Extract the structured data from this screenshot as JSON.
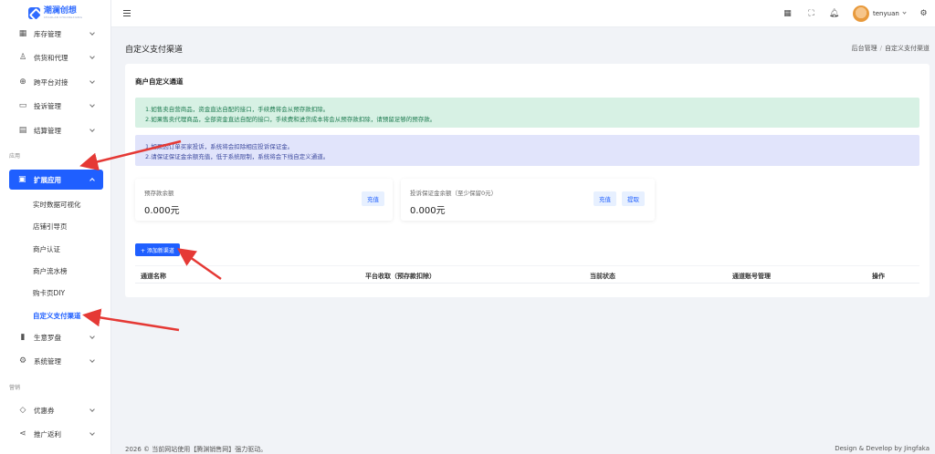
{
  "logo": {
    "name": "潮澜创想",
    "sub": "CHAOLAN CHUANGXIANG"
  },
  "sidebar": {
    "items": [
      {
        "label": "库存管理",
        "icon": "inventory-icon"
      },
      {
        "label": "供货和代理",
        "icon": "users-icon"
      },
      {
        "label": "跨平台对接",
        "icon": "globe-icon"
      },
      {
        "label": "投诉管理",
        "icon": "complaint-icon"
      },
      {
        "label": "结算管理",
        "icon": "settlement-icon"
      }
    ],
    "section_app": "应用",
    "active_group": "扩展应用",
    "sub_items": [
      "实时数据可视化",
      "店铺引导页",
      "商户认证",
      "商户流水榜",
      "购卡页DIY",
      "自定义支付渠道"
    ],
    "items2": [
      {
        "label": "生意罗盘",
        "icon": "chart-icon"
      },
      {
        "label": "系统管理",
        "icon": "gear-icon"
      }
    ],
    "section_marketing": "营销",
    "items3": [
      {
        "label": "优惠券",
        "icon": "coupon-icon"
      },
      {
        "label": "推广返利",
        "icon": "share-icon"
      }
    ]
  },
  "header": {
    "username": "tenyuan"
  },
  "page": {
    "title": "自定义支付渠道",
    "breadcrumb": [
      "后台管理",
      "自定义支付渠道"
    ],
    "breadcrumb_sep": "/"
  },
  "card": {
    "title": "商户自定义通道",
    "alert_green": [
      "1.如售卖自营商品，资金直达自配的接口，手续费将会从预存款扣除。",
      "2.如果售卖代理商品，全部资金直达自配的接口，手续费和进货成本将会从预存款扣除，请预留足够的预存款。"
    ],
    "alert_blue": [
      "1.如果因订单买家投诉，系统将会扣除相应投诉保证金。",
      "2.请保证保证金余额充值，低于系统限制，系统将会下线自定义通道。"
    ],
    "prepaid": {
      "label": "预存款余额",
      "value": "0.000元",
      "recharge": "充值"
    },
    "deposit": {
      "label": "投诉保证金余额（至少保留0元）",
      "value": "0.000元",
      "recharge": "充值",
      "withdraw": "提取"
    },
    "add_button": "+ 添加新渠道",
    "columns": [
      "通道名称",
      "平台收取（预存款扣除）",
      "当前状态",
      "通道账号管理",
      "操作"
    ]
  },
  "footer": {
    "left": "2026 © 当前网站使用【腾渊销售网】强力驱动。",
    "right": "Design & Develop by Jingfaka"
  },
  "colors": {
    "primary": "#1f5fff",
    "annotation": "#e53935"
  }
}
